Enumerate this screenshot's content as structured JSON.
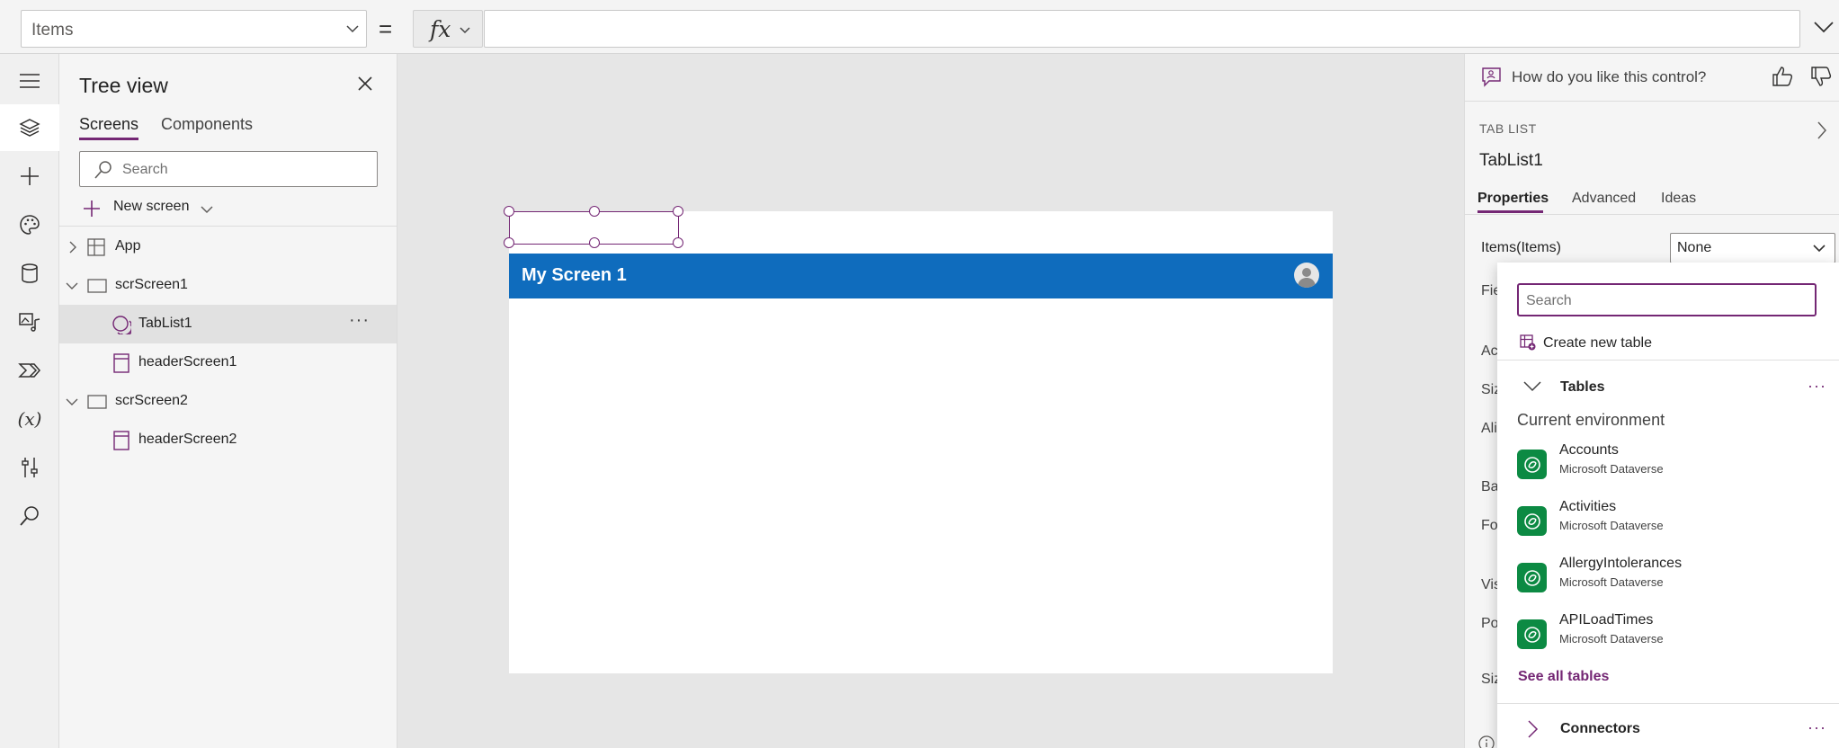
{
  "formula_bar": {
    "property": "Items",
    "equals": "=",
    "fx_label": "fx",
    "formula": ""
  },
  "left_rail": {
    "items": [
      "menu-icon",
      "layers-icon",
      "add-icon",
      "palette-icon",
      "database-icon",
      "media-icon",
      "power-automate-icon",
      "variables-icon",
      "tools-icon",
      "search-icon"
    ],
    "variables_glyph": "(x)"
  },
  "tree_view": {
    "title": "Tree view",
    "tabs": [
      "Screens",
      "Components"
    ],
    "search_placeholder": "Search",
    "new_screen": "New screen",
    "nodes": [
      {
        "label": "App",
        "kind": "app"
      },
      {
        "label": "scrScreen1",
        "kind": "screen"
      },
      {
        "label": "TabList1",
        "kind": "tablist"
      },
      {
        "label": "headerScreen1",
        "kind": "header"
      },
      {
        "label": "scrScreen2",
        "kind": "screen"
      },
      {
        "label": "headerScreen2",
        "kind": "header"
      }
    ],
    "more": "···"
  },
  "canvas": {
    "screen_title": "My Screen 1"
  },
  "right_panel": {
    "feedback": "How do you like this control?",
    "control_type": "TAB LIST",
    "control_name": "TabList1",
    "tabs": [
      "Properties",
      "Advanced",
      "Ideas"
    ],
    "items_label": "Items(Items)",
    "items_value": "None",
    "partial_labels": [
      "Fie",
      "Ac",
      "Siz",
      "Ali",
      "Ba",
      "Fo",
      "Vis",
      "Po",
      "Siz"
    ]
  },
  "dropdown": {
    "search_placeholder": "Search",
    "create_new": "Create new table",
    "tables_label": "Tables",
    "more": "···",
    "env_label": "Current environment",
    "items": [
      {
        "name": "Accounts",
        "source": "Microsoft Dataverse"
      },
      {
        "name": "Activities",
        "source": "Microsoft Dataverse"
      },
      {
        "name": "AllergyIntolerances",
        "source": "Microsoft Dataverse"
      },
      {
        "name": "APILoadTimes",
        "source": "Microsoft Dataverse"
      }
    ],
    "see_all": "See all tables",
    "connectors_label": "Connectors"
  },
  "colors": {
    "accent": "#742774",
    "header_blue": "#0f6cbd",
    "dataverse_green": "#0c8a43"
  }
}
